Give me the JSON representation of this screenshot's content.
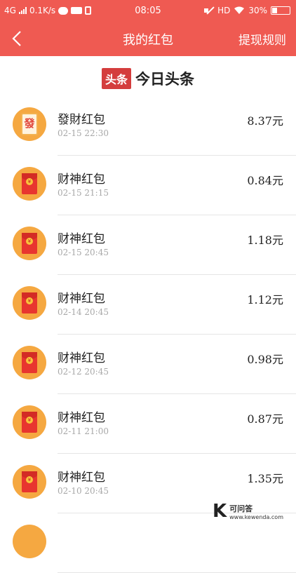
{
  "status_bar": {
    "network": "4G",
    "speed": "0.1K/s",
    "time": "08:05",
    "hd": "HD",
    "battery": "30%",
    "battery_level": 0.3
  },
  "header": {
    "back_icon": "chevron-left-icon",
    "title": "我的红包",
    "rules_label": "提现规则"
  },
  "brand": {
    "logo": "头条",
    "name": "今日头条"
  },
  "items": [
    {
      "name": "發財红包",
      "time": "02-15 22:30",
      "amount": "8.37元",
      "icon": "fa-card-icon"
    },
    {
      "name": "财神红包",
      "time": "02-15 21:15",
      "amount": "0.84元",
      "icon": "red-envelope-icon"
    },
    {
      "name": "财神红包",
      "time": "02-15 20:45",
      "amount": "1.18元",
      "icon": "red-envelope-icon"
    },
    {
      "name": "财神红包",
      "time": "02-14 20:45",
      "amount": "1.12元",
      "icon": "red-envelope-icon"
    },
    {
      "name": "财神红包",
      "time": "02-12 20:45",
      "amount": "0.98元",
      "icon": "red-envelope-icon"
    },
    {
      "name": "财神红包",
      "time": "02-11 21:00",
      "amount": "0.87元",
      "icon": "red-envelope-icon"
    },
    {
      "name": "财神红包",
      "time": "02-10 20:45",
      "amount": "1.35元",
      "icon": "red-envelope-icon"
    }
  ],
  "fa_glyph": "發",
  "coin_glyph": "¥",
  "watermark": {
    "letter": "K",
    "name": "可问答",
    "url": "www.kewenda.com"
  },
  "colors": {
    "header_bg": "#ef5a52",
    "avatar_bg": "#f5a841",
    "envelope": "#e8352f"
  }
}
